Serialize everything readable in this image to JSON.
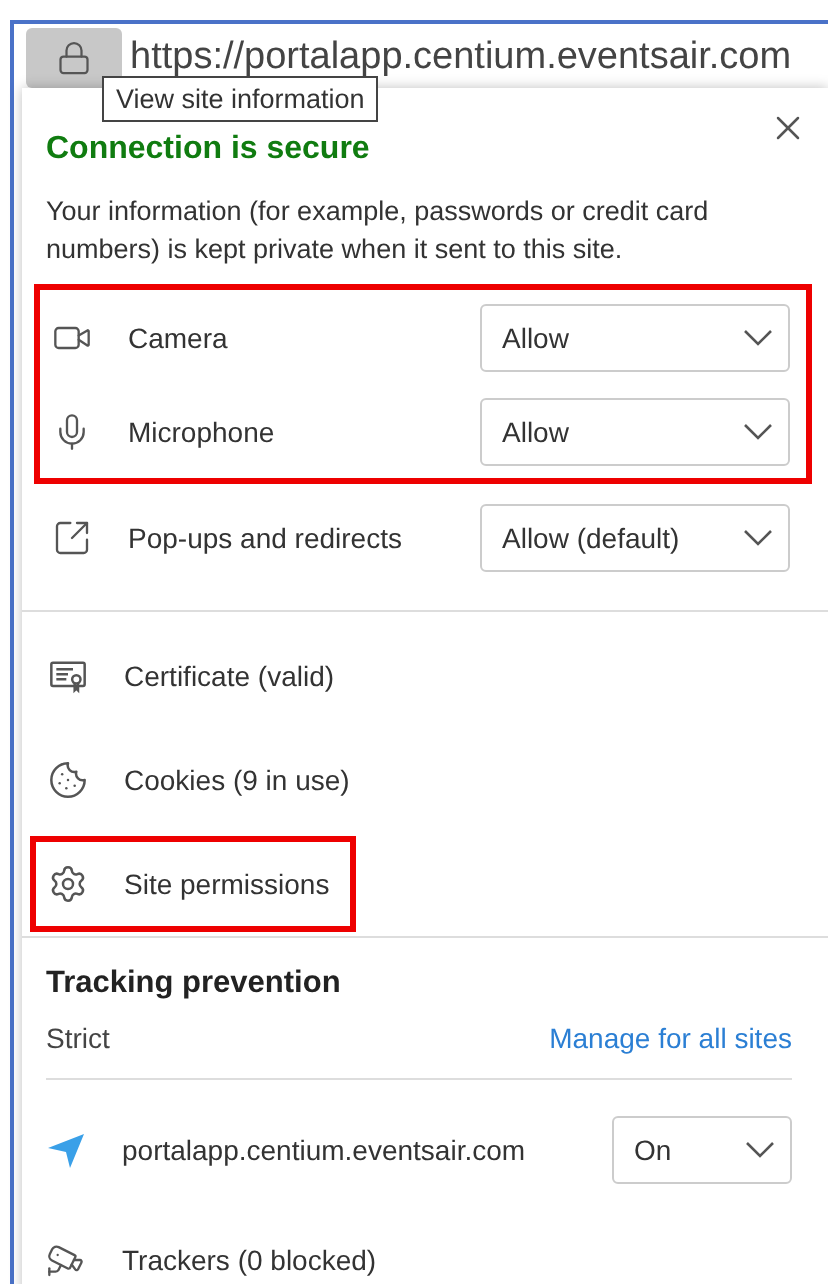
{
  "address_bar": {
    "url": "https://portalapp.centium.eventsair.com"
  },
  "tooltip": {
    "text": "View site information"
  },
  "panel": {
    "title": "Connection is secure",
    "description": "Your information (for example, passwords or credit card numbers) is kept private when it sent to this site.",
    "permission_groups": [
      {
        "highlighted": true,
        "rows": [
          {
            "label": "Camera",
            "value": "Allow"
          },
          {
            "label": "Microphone",
            "value": "Allow"
          }
        ]
      },
      {
        "highlighted": false,
        "rows": [
          {
            "label": "Pop-ups and redirects",
            "value": "Allow (default)"
          }
        ]
      }
    ],
    "links": [
      {
        "label": "Certificate (valid)",
        "highlighted": false
      },
      {
        "label": "Cookies (9 in use)",
        "highlighted": false
      },
      {
        "label": "Site permissions",
        "highlighted": true
      }
    ],
    "tracking": {
      "title": "Tracking prevention",
      "mode": "Strict",
      "manage_link": "Manage for all sites",
      "site": {
        "domain": "portalapp.centium.eventsair.com",
        "value": "On"
      },
      "trackers": "Trackers (0 blocked)"
    }
  }
}
